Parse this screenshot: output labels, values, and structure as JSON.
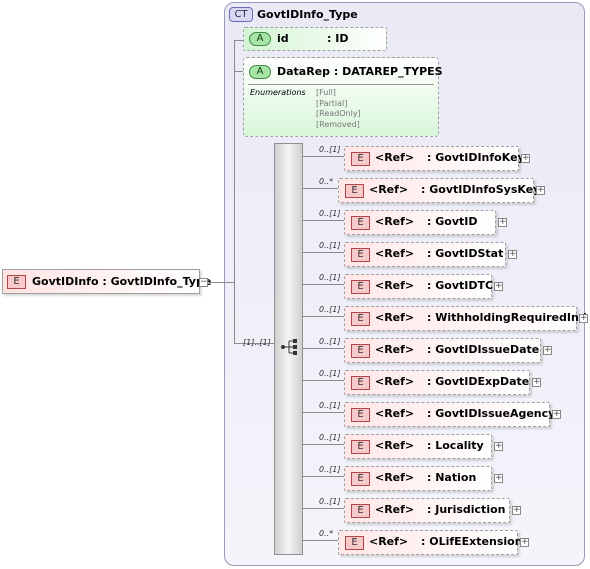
{
  "root_element": {
    "badge": "E",
    "name": "GovtIDInfo",
    "type": ": GovtIDInfo_Type",
    "collapse": "−"
  },
  "complex_type": {
    "badge": "CT",
    "name": "GovtIDInfo_Type"
  },
  "attributes": [
    {
      "badge": "A",
      "name": "id",
      "type": ": ID"
    },
    {
      "badge": "A",
      "name": "DataRep",
      "type": ": DATAREP_TYPES",
      "enumerations_label": "Enumerations",
      "enumerations": [
        "[Full]",
        "[Partial]",
        "[ReadOnly]",
        "[Removed]"
      ]
    }
  ],
  "sequence": {
    "multiplicity": "[1]..[1]"
  },
  "elements": [
    {
      "badge": "E",
      "mult": "0..[1]",
      "ref": "<Ref>",
      "name": ": GovtIDInfoKey",
      "expand": "+"
    },
    {
      "badge": "E",
      "mult": "0..*",
      "ref": "<Ref>",
      "name": ": GovtIDInfoSysKey",
      "expand": "+"
    },
    {
      "badge": "E",
      "mult": "0..[1]",
      "ref": "<Ref>",
      "name": ": GovtID",
      "expand": "+"
    },
    {
      "badge": "E",
      "mult": "0..[1]",
      "ref": "<Ref>",
      "name": ": GovtIDStat",
      "expand": "+"
    },
    {
      "badge": "E",
      "mult": "0..[1]",
      "ref": "<Ref>",
      "name": ": GovtIDTC",
      "expand": "+"
    },
    {
      "badge": "E",
      "mult": "0..[1]",
      "ref": "<Ref>",
      "name": ": WithholdingRequiredInd",
      "expand": "+"
    },
    {
      "badge": "E",
      "mult": "0..[1]",
      "ref": "<Ref>",
      "name": ": GovtIDIssueDate",
      "expand": "+"
    },
    {
      "badge": "E",
      "mult": "0..[1]",
      "ref": "<Ref>",
      "name": ": GovtIDExpDate",
      "expand": "+"
    },
    {
      "badge": "E",
      "mult": "0..[1]",
      "ref": "<Ref>",
      "name": ": GovtIDIssueAgency",
      "expand": "+"
    },
    {
      "badge": "E",
      "mult": "0..[1]",
      "ref": "<Ref>",
      "name": ": Locality",
      "expand": "+"
    },
    {
      "badge": "E",
      "mult": "0..[1]",
      "ref": "<Ref>",
      "name": ": Nation",
      "expand": "+"
    },
    {
      "badge": "E",
      "mult": "0..[1]",
      "ref": "<Ref>",
      "name": ": Jurisdiction",
      "expand": "+"
    },
    {
      "badge": "E",
      "mult": "0..*",
      "ref": "<Ref>",
      "name": ": OLifEExtension",
      "expand": "+"
    }
  ]
}
